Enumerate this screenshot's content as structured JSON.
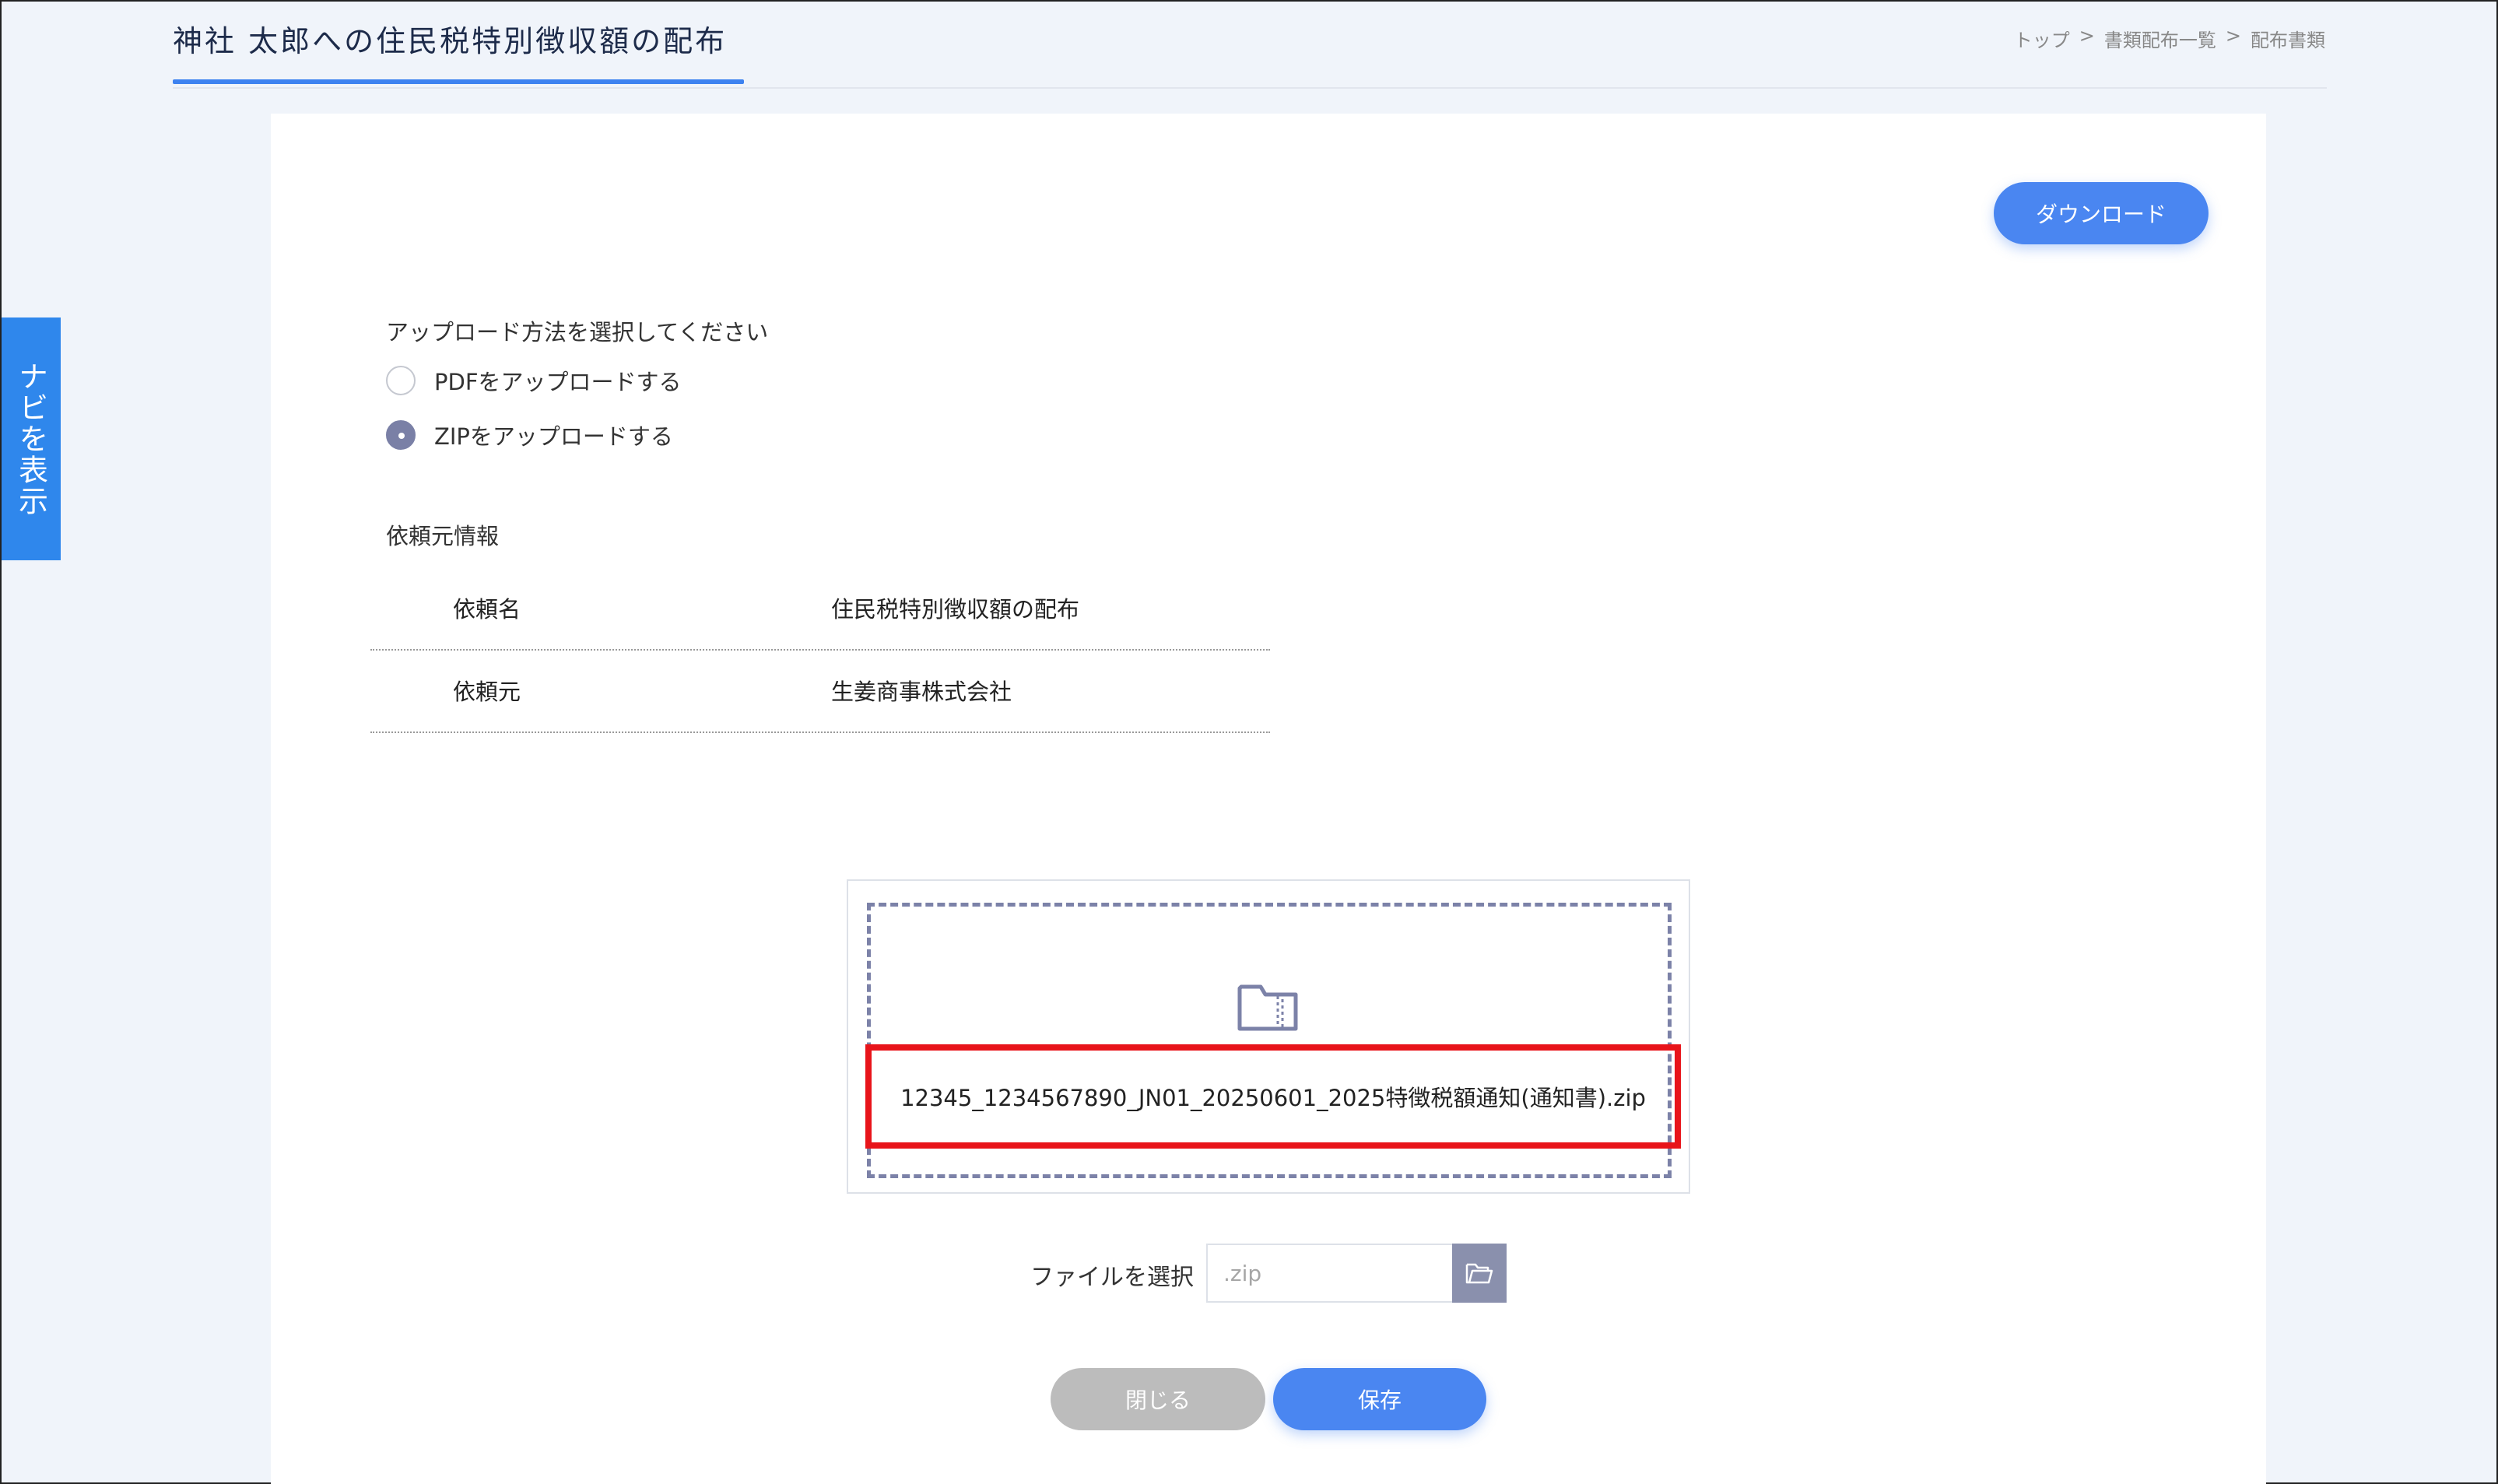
{
  "header": {
    "title": "神社 太郎への住民税特別徴収額の配布",
    "breadcrumb": [
      "トップ",
      ">",
      "書類配布一覧",
      ">",
      "配布書類"
    ]
  },
  "nav": {
    "label": "ナビを表示"
  },
  "toolbar": {
    "download_label": "ダウンロード"
  },
  "upload_method": {
    "prompt": "アップロード方法を選択してください",
    "options": [
      {
        "label": "PDFをアップロードする",
        "selected": false
      },
      {
        "label": "ZIPをアップロードする",
        "selected": true
      }
    ]
  },
  "requester": {
    "section_label": "依頼元情報",
    "rows": [
      {
        "key": "依頼名",
        "value": "住民税特別徴収額の配布"
      },
      {
        "key": "依頼元",
        "value": "生姜商事株式会社"
      }
    ]
  },
  "dropzone": {
    "icon": "zip-folder-icon",
    "filename": "12345_1234567890_JN01_20250601_2025特徴税額通知(通知書).zip",
    "highlight_color": "#e8141a"
  },
  "file_select": {
    "label": "ファイルを選択",
    "placeholder": ".zip",
    "value": ""
  },
  "footer": {
    "close_label": "閉じる",
    "save_label": "保存"
  },
  "colors": {
    "accent": "#4a86f1",
    "nav": "#2f87ec",
    "radio_checked": "#7a80a6"
  }
}
